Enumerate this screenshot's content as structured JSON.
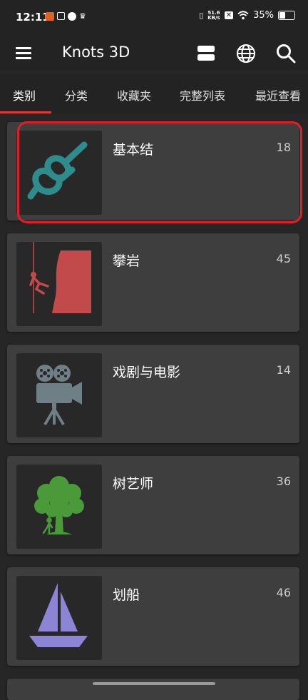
{
  "status_bar": {
    "time": "12:11",
    "speed_value": "51.6",
    "speed_unit": "KB/s",
    "battery": "35%"
  },
  "app_bar": {
    "title": "Knots 3D",
    "icons": [
      "menu-icon",
      "view-toggle-icon",
      "globe-icon",
      "search-icon"
    ]
  },
  "tabs": [
    {
      "label": "类别",
      "active": true
    },
    {
      "label": "分类",
      "active": false
    },
    {
      "label": "收藏夹",
      "active": false
    },
    {
      "label": "完整列表",
      "active": false
    },
    {
      "label": "最近查看",
      "active": false
    }
  ],
  "categories": [
    {
      "name": "基本结",
      "count": "18",
      "icon": "knot-icon",
      "color": "#2f8c8c"
    },
    {
      "name": "攀岩",
      "count": "45",
      "icon": "climbing-icon",
      "color": "#c24a4a"
    },
    {
      "name": "戏剧与电影",
      "count": "14",
      "icon": "film-camera-icon",
      "color": "#6f7f86"
    },
    {
      "name": "树艺师",
      "count": "36",
      "icon": "tree-icon",
      "color": "#4a9a3a"
    },
    {
      "name": "划船",
      "count": "46",
      "icon": "sailboat-icon",
      "color": "#8e84d6"
    }
  ],
  "colors": {
    "accent": "#e53935",
    "highlight_outline": "#e01e26",
    "card_bg": "#3e3e3e",
    "page_bg": "#262626"
  }
}
